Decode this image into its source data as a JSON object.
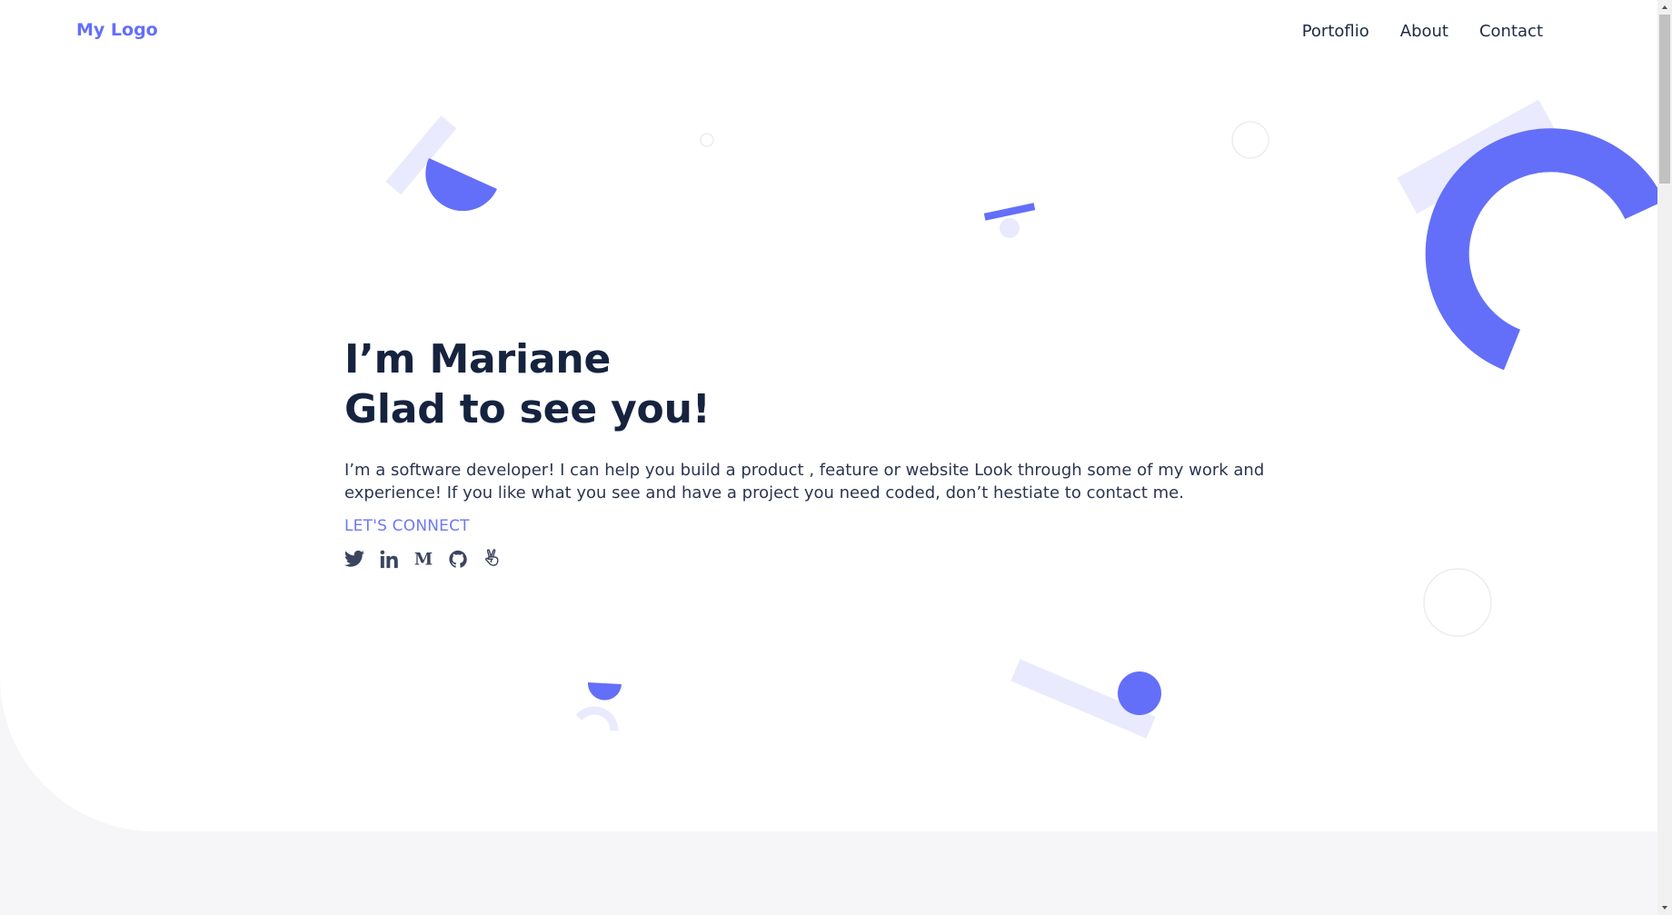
{
  "header": {
    "logo": "My Logo",
    "nav": [
      {
        "label": "Portoflio"
      },
      {
        "label": "About"
      },
      {
        "label": "Contact"
      }
    ]
  },
  "hero": {
    "title_line1": "I’m Mariane",
    "title_line2": "Glad to see you!",
    "description": "I’m a software developer! I can help you build a product , feature or website Look through some of my work and experience! If you like what you see and have a project you need coded, don’t hestiate to contact me.",
    "connect_label": "LET'S CONNECT",
    "social_icons": [
      "twitter-icon",
      "linkedin-icon",
      "medium-icon",
      "github-icon",
      "angellist-icon"
    ]
  },
  "colors": {
    "accent": "#636ff8",
    "accent_light": "#e9eafd",
    "heading": "#15233f",
    "text": "#2c3550",
    "background": "#f6f6f8"
  }
}
